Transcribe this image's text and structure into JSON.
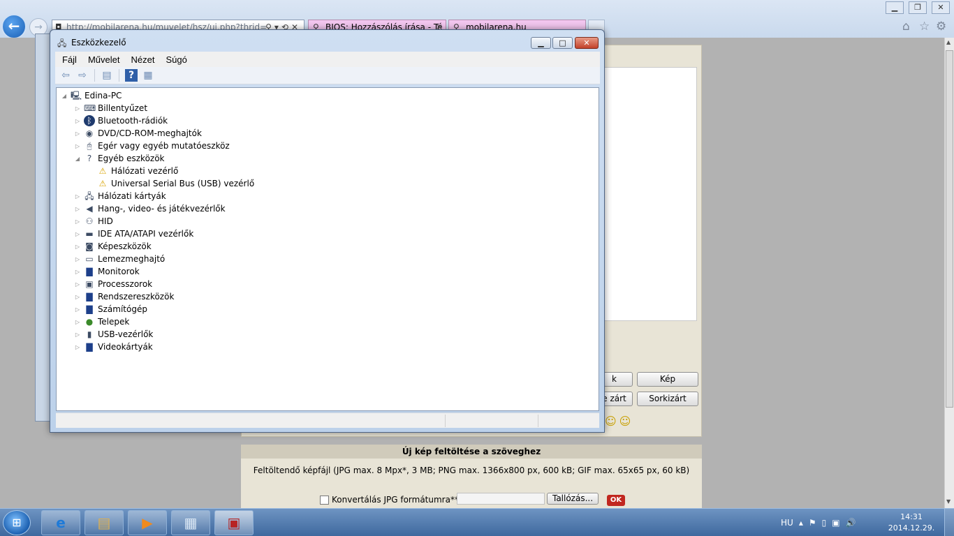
{
  "browser": {
    "address": "http://mobilarena.hu/muvelet/hsz/uj.php?thrid=",
    "tabs": [
      {
        "label": "BIOS: Hozzászólás írása - Té"
      },
      {
        "label": "mobilarena.hu"
      }
    ]
  },
  "dialog": {
    "title": "Eszközkezelő",
    "menu": [
      "Fájl",
      "Művelet",
      "Nézet",
      "Súgó"
    ],
    "root": "Edina-PC",
    "items": [
      {
        "label": "Billentyűzet",
        "icon": "keyboard-icon",
        "expanded": false
      },
      {
        "label": "Bluetooth-rádiók",
        "icon": "bluetooth-icon",
        "expanded": false
      },
      {
        "label": "DVD/CD-ROM-meghajtók",
        "icon": "dvd-drive-icon",
        "expanded": false
      },
      {
        "label": "Egér vagy egyéb mutatóeszköz",
        "icon": "mouse-icon",
        "expanded": false
      },
      {
        "label": "Egyéb eszközök",
        "icon": "unknown-device-icon",
        "expanded": true,
        "children": [
          {
            "label": "Hálózati vezérlő",
            "icon": "warning-icon"
          },
          {
            "label": "Universal Serial Bus (USB) vezérlő",
            "icon": "warning-icon"
          }
        ]
      },
      {
        "label": "Hálózati kártyák",
        "icon": "network-adapter-icon",
        "expanded": false
      },
      {
        "label": "Hang-, video- és játékvezérlők",
        "icon": "speaker-icon",
        "expanded": false
      },
      {
        "label": "HID",
        "icon": "hid-icon",
        "expanded": false
      },
      {
        "label": "IDE ATA/ATAPI vezérlők",
        "icon": "ide-controller-icon",
        "expanded": false
      },
      {
        "label": "Képeszközök",
        "icon": "camera-icon",
        "expanded": false
      },
      {
        "label": "Lemezmeghajtó",
        "icon": "disk-drive-icon",
        "expanded": false
      },
      {
        "label": "Monitorok",
        "icon": "monitor-icon",
        "expanded": false
      },
      {
        "label": "Processzorok",
        "icon": "processor-icon",
        "expanded": false
      },
      {
        "label": "Rendszereszközök",
        "icon": "system-device-icon",
        "expanded": false
      },
      {
        "label": "Számítógép",
        "icon": "computer-icon",
        "expanded": false
      },
      {
        "label": "Telepek",
        "icon": "battery-icon",
        "expanded": false
      },
      {
        "label": "USB-vezérlők",
        "icon": "usb-icon",
        "expanded": false
      },
      {
        "label": "Videokártyák",
        "icon": "display-adapter-icon",
        "expanded": false
      }
    ]
  },
  "page": {
    "buttons": {
      "kep": "Kép",
      "sorkizart": "Sorkizárt",
      "partial_k": "k",
      "partial_zart": "e zárt"
    },
    "upload_title": "Új kép feltöltése a szöveghez",
    "upload_desc": "Feltöltendő képfájl (JPG max. 8 Mpx*, 3 MB; PNG max. 1366x800 px, 600 kB; GIF max. 65x65 px, 60 kB)",
    "convert_label": "Konvertálás JPG formátumra**",
    "browse_label": "Tallózás...",
    "ok_label": "OK"
  },
  "taskbar": {
    "lang": "HU",
    "time": "14:31",
    "date": "2014.12.29."
  }
}
